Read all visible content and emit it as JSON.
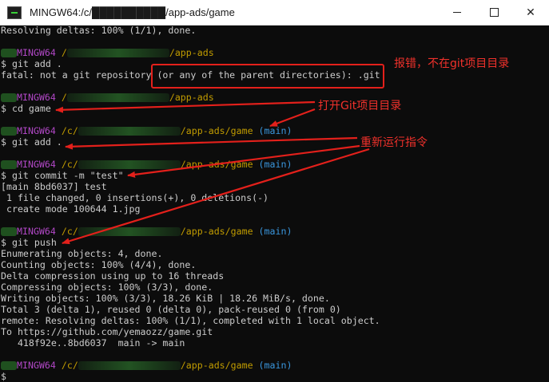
{
  "window": {
    "title": "MINGW64:/c/██████████/app-ads/game",
    "minimize_glyph": "—",
    "maximize_glyph": "□",
    "close_glyph": "✕"
  },
  "terminal": {
    "line1": "Resolving deltas: 100% (1/1), done.",
    "host": "MINGW64",
    "path_prefix": "/",
    "path_c_prefix": "/c/",
    "path_app_ads": "/app-ads",
    "path_app_ads_game": "/app-ads/game",
    "branch": "(main)",
    "cmd_git_add": "$ git add .",
    "fatal_msg": "fatal: not a git repository (or any of the parent directories): .git",
    "cmd_cd_game": "$ cd game",
    "cmd_git_add2": "$ git add .",
    "cmd_commit": "$ git commit -m \"test\"",
    "commit_line1": "[main 8bd6037] test",
    "commit_line2": " 1 file changed, 0 insertions(+), 0 deletions(-)",
    "commit_line3": " create mode 100644 1.jpg",
    "cmd_push": "$ git push",
    "push_lines": [
      "Enumerating objects: 4, done.",
      "Counting objects: 100% (4/4), done.",
      "Delta compression using up to 16 threads",
      "Compressing objects: 100% (3/3), done.",
      "Writing objects: 100% (3/3), 18.26 KiB | 18.26 MiB/s, done.",
      "Total 3 (delta 1), reused 0 (delta 0), pack-reused 0 (from 0)",
      "remote: Resolving deltas: 100% (1/1), completed with 1 local object.",
      "To https://github.com/yemaozz/game.git",
      "   418f92e..8bd6037  main -> main"
    ],
    "prompt_dollar": "$"
  },
  "annotations": {
    "error_note": "报错，不在git项目目录",
    "open_note": "打开Git项目目录",
    "rerun_note": "重新运行指令",
    "color": "#e3201b"
  }
}
